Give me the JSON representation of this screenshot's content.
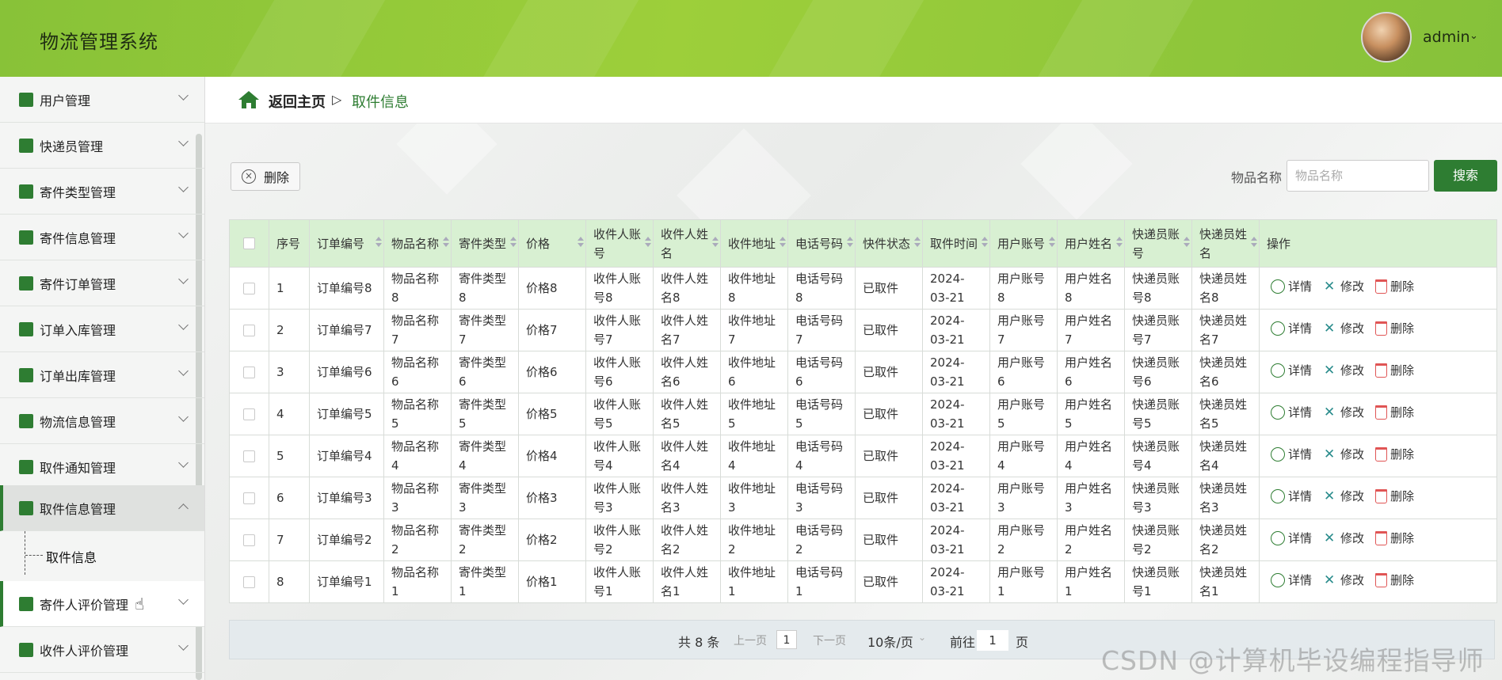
{
  "header": {
    "title": "物流管理系统",
    "user_name": "admin",
    "user_caret": "⌄"
  },
  "sidebar": {
    "items": [
      {
        "label": "用户管理",
        "icon": "clipboard-check-icon"
      },
      {
        "label": "快递员管理",
        "icon": "book-icon"
      },
      {
        "label": "寄件类型管理",
        "icon": "chart-icon"
      },
      {
        "label": "寄件信息管理",
        "icon": "clipboard-check-icon"
      },
      {
        "label": "寄件订单管理",
        "icon": "grid-icon"
      },
      {
        "label": "订单入库管理",
        "icon": "monitor-icon"
      },
      {
        "label": "订单出库管理",
        "icon": "sliders-icon"
      },
      {
        "label": "物流信息管理",
        "icon": "ticket-icon"
      },
      {
        "label": "取件通知管理",
        "icon": "grid-icon"
      },
      {
        "label": "取件信息管理",
        "icon": "user-icon"
      },
      {
        "label": "寄件人评价管理",
        "icon": "chat-icon"
      },
      {
        "label": "收件人评价管理",
        "icon": "clipboard-list-icon"
      }
    ],
    "submenu_label": "取件信息"
  },
  "breadcrumb": {
    "home": "返回主页",
    "separator": "▷",
    "current": "取件信息"
  },
  "toolbar": {
    "delete_label": "删除",
    "search_label": "物品名称",
    "search_placeholder": "物品名称",
    "search_button": "搜索"
  },
  "table": {
    "headers": [
      "序号",
      "订单编号",
      "物品名称",
      "寄件类型",
      "价格",
      "收件人账号",
      "收件人姓名",
      "收件地址",
      "电话号码",
      "快件状态",
      "取件时间",
      "用户账号",
      "用户姓名",
      "快递员账号",
      "快递员姓名",
      "操作"
    ],
    "ops": {
      "detail": "详情",
      "edit": "修改",
      "delete": "删除"
    },
    "rows": [
      [
        "1",
        "订单编号8",
        "物品名称8",
        "寄件类型8",
        "价格8",
        "收件人账号8",
        "收件人姓名8",
        "收件地址8",
        "电话号码8",
        "已取件",
        "2024-03-21",
        "用户账号8",
        "用户姓名8",
        "快递员账号8",
        "快递员姓名8"
      ],
      [
        "2",
        "订单编号7",
        "物品名称7",
        "寄件类型7",
        "价格7",
        "收件人账号7",
        "收件人姓名7",
        "收件地址7",
        "电话号码7",
        "已取件",
        "2024-03-21",
        "用户账号7",
        "用户姓名7",
        "快递员账号7",
        "快递员姓名7"
      ],
      [
        "3",
        "订单编号6",
        "物品名称6",
        "寄件类型6",
        "价格6",
        "收件人账号6",
        "收件人姓名6",
        "收件地址6",
        "电话号码6",
        "已取件",
        "2024-03-21",
        "用户账号6",
        "用户姓名6",
        "快递员账号6",
        "快递员姓名6"
      ],
      [
        "4",
        "订单编号5",
        "物品名称5",
        "寄件类型5",
        "价格5",
        "收件人账号5",
        "收件人姓名5",
        "收件地址5",
        "电话号码5",
        "已取件",
        "2024-03-21",
        "用户账号5",
        "用户姓名5",
        "快递员账号5",
        "快递员姓名5"
      ],
      [
        "5",
        "订单编号4",
        "物品名称4",
        "寄件类型4",
        "价格4",
        "收件人账号4",
        "收件人姓名4",
        "收件地址4",
        "电话号码4",
        "已取件",
        "2024-03-21",
        "用户账号4",
        "用户姓名4",
        "快递员账号4",
        "快递员姓名4"
      ],
      [
        "6",
        "订单编号3",
        "物品名称3",
        "寄件类型3",
        "价格3",
        "收件人账号3",
        "收件人姓名3",
        "收件地址3",
        "电话号码3",
        "已取件",
        "2024-03-21",
        "用户账号3",
        "用户姓名3",
        "快递员账号3",
        "快递员姓名3"
      ],
      [
        "7",
        "订单编号2",
        "物品名称2",
        "寄件类型2",
        "价格2",
        "收件人账号2",
        "收件人姓名2",
        "收件地址2",
        "电话号码2",
        "已取件",
        "2024-03-21",
        "用户账号2",
        "用户姓名2",
        "快递员账号2",
        "快递员姓名2"
      ],
      [
        "8",
        "订单编号1",
        "物品名称1",
        "寄件类型1",
        "价格1",
        "收件人账号1",
        "收件人姓名1",
        "收件地址1",
        "电话号码1",
        "已取件",
        "2024-03-21",
        "用户账号1",
        "用户姓名1",
        "快递员账号1",
        "快递员姓名1"
      ]
    ]
  },
  "pagination": {
    "total": "共 8 条",
    "prev": "上一页",
    "current_page": "1",
    "next": "下一页",
    "page_size": "10条/页",
    "goto_label": "前往",
    "goto_value": "1",
    "page_suffix": "页"
  },
  "watermark": "CSDN @计算机毕设编程指导师",
  "colors": {
    "accent": "#2e7d32",
    "header_green": "#9dcf3a",
    "table_header": "#d8f0d2"
  }
}
